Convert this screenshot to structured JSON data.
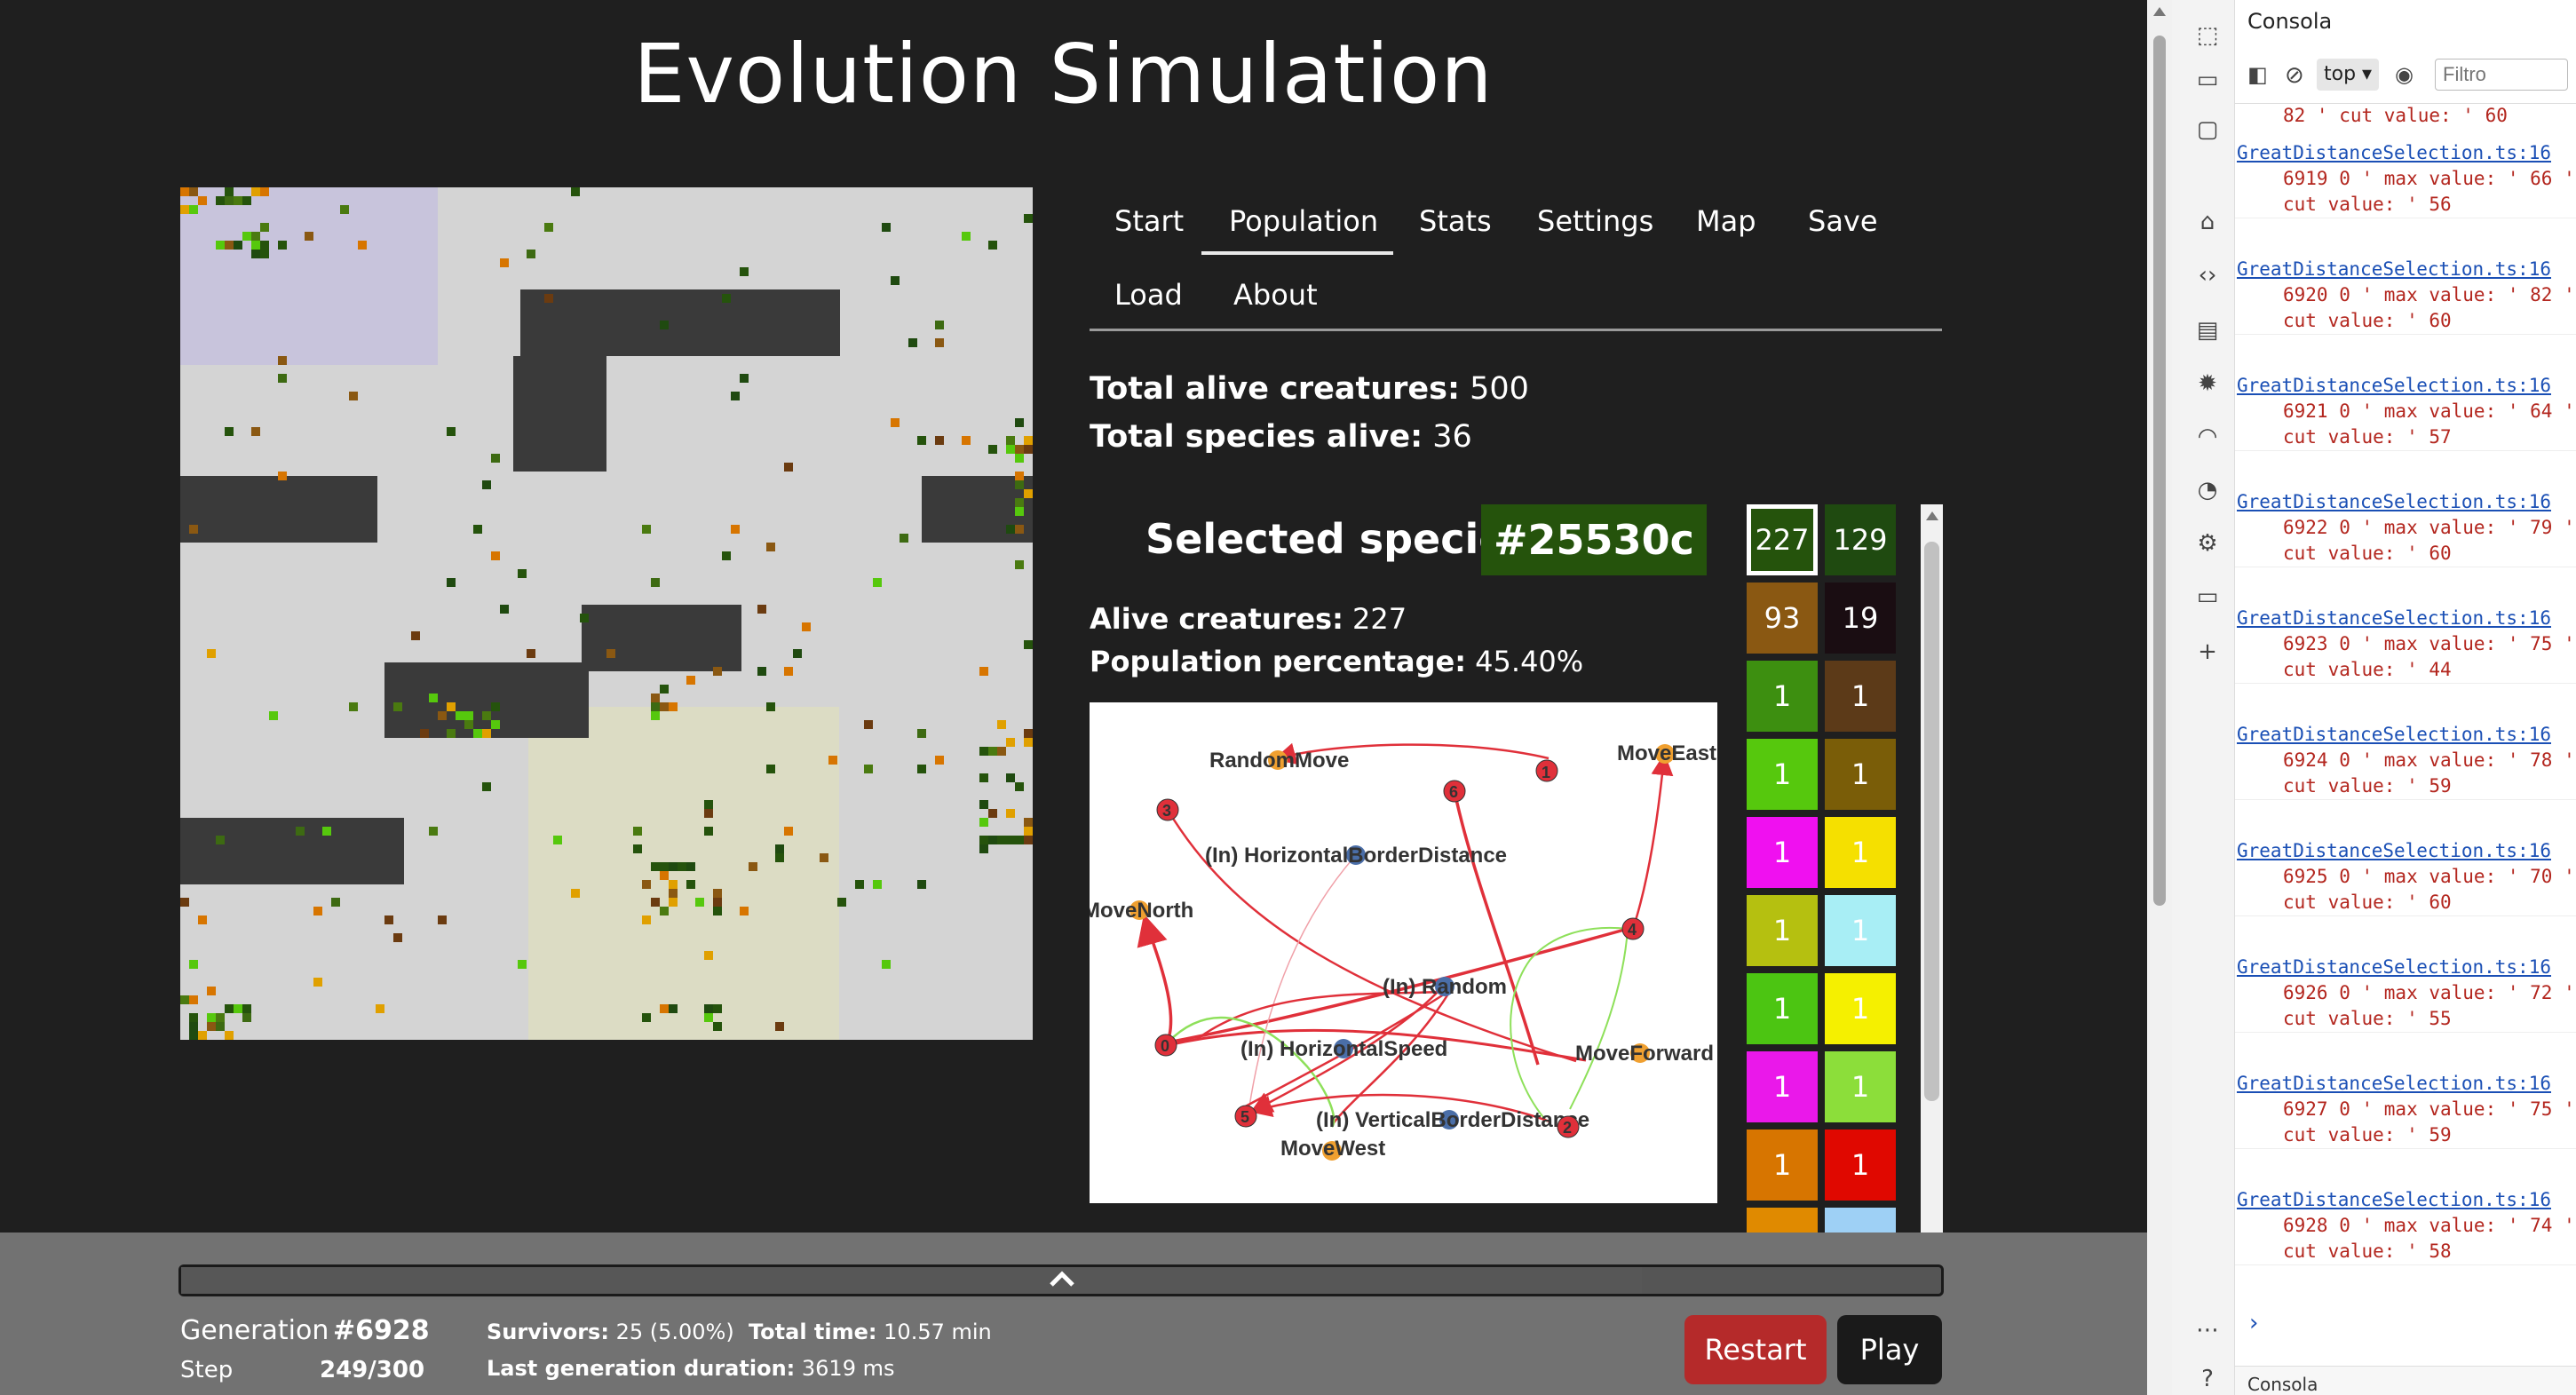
{
  "page": {
    "title": "Evolution Simulation"
  },
  "tabs": [
    {
      "label": "Start"
    },
    {
      "label": "Population",
      "active": true
    },
    {
      "label": "Stats"
    },
    {
      "label": "Settings"
    },
    {
      "label": "Map"
    },
    {
      "label": "Save"
    },
    {
      "label": "Load"
    },
    {
      "label": "About"
    }
  ],
  "population": {
    "total_alive_label": "Total alive creatures:",
    "total_alive_value": "500",
    "species_alive_label": "Total species alive:",
    "species_alive_value": "36",
    "selected_label": "Selected species",
    "selected_code": "#25530c",
    "alive_label": "Alive creatures:",
    "alive_value": "227",
    "pct_label": "Population percentage:",
    "pct_value": "45.40%"
  },
  "species_grid": [
    {
      "count": "227",
      "color": "#25530c",
      "selected": true
    },
    {
      "count": "129",
      "color": "#1f4a10"
    },
    {
      "count": "93",
      "color": "#8a5812"
    },
    {
      "count": "19",
      "color": "#1a0d12"
    },
    {
      "count": "1",
      "color": "#3d8f10"
    },
    {
      "count": "1",
      "color": "#5c3a18"
    },
    {
      "count": "1",
      "color": "#56c80d"
    },
    {
      "count": "1",
      "color": "#7a5d08"
    },
    {
      "count": "1",
      "color": "#f010f0"
    },
    {
      "count": "1",
      "color": "#f5e000"
    },
    {
      "count": "1",
      "color": "#b5c010"
    },
    {
      "count": "1",
      "color": "#a8eef5"
    },
    {
      "count": "1",
      "color": "#4cc512"
    },
    {
      "count": "1",
      "color": "#f5f000"
    },
    {
      "count": "1",
      "color": "#ea18ea"
    },
    {
      "count": "1",
      "color": "#8cde3a"
    },
    {
      "count": "1",
      "color": "#d77500"
    },
    {
      "count": "1",
      "color": "#e00800"
    },
    {
      "count": "",
      "color": "#e08a00"
    },
    {
      "count": "",
      "color": "#9ed0f5"
    }
  ],
  "neural_graph": {
    "nodes": [
      {
        "label": "RandomMove",
        "kind": "output"
      },
      {
        "label": "1",
        "kind": "hidden"
      },
      {
        "label": "MoveEast",
        "kind": "output"
      },
      {
        "label": "3",
        "kind": "hidden"
      },
      {
        "label": "6",
        "kind": "hidden"
      },
      {
        "label": "(In) HorizontalBorderDistance",
        "kind": "input"
      },
      {
        "label": "MoveNorth",
        "kind": "output"
      },
      {
        "label": "4",
        "kind": "hidden"
      },
      {
        "label": "(In) Random",
        "kind": "input"
      },
      {
        "label": "0",
        "kind": "hidden"
      },
      {
        "label": "(In) HorizontalSpeed",
        "kind": "input"
      },
      {
        "label": "MoveForward",
        "kind": "output"
      },
      {
        "label": "5",
        "kind": "hidden"
      },
      {
        "label": "(In) VerticalBorderDistance",
        "kind": "input"
      },
      {
        "label": "2",
        "kind": "hidden"
      },
      {
        "label": "MoveWest",
        "kind": "output"
      }
    ]
  },
  "bottom": {
    "generation_label": "Generation",
    "generation_value": "#6928",
    "step_label": "Step",
    "step_value": "249/300",
    "step_fraction": 0.83,
    "survivors_label": "Survivors:",
    "survivors_value": "25 (5.00%)",
    "total_time_label": "Total time:",
    "total_time_value": "10.57 min",
    "last_gen_label": "Last generation duration:",
    "last_gen_value": "3619 ms",
    "restart_label": "Restart",
    "play_label": "Play",
    "restart_color": "#b52a2a",
    "play_color": "#1a1a1a"
  },
  "devtools": {
    "panel_title": "Consola",
    "context_select": "top",
    "filter_placeholder": "Filtro",
    "first_partial": "82 ' cut value: ' 60",
    "logs": [
      {
        "source": "GreatDistanceSelection.ts:16",
        "text": "6919 0 ' max value: ' 66 ' cut value: ' 56"
      },
      {
        "source": "GreatDistanceSelection.ts:16",
        "text": "6920 0 ' max value: ' 82 ' cut value: ' 60"
      },
      {
        "source": "GreatDistanceSelection.ts:16",
        "text": "6921 0 ' max value: ' 64 ' cut value: ' 57"
      },
      {
        "source": "GreatDistanceSelection.ts:16",
        "text": "6922 0 ' max value: ' 79 ' cut value: ' 60"
      },
      {
        "source": "GreatDistanceSelection.ts:16",
        "text": "6923 0 ' max value: ' 75 ' cut value: ' 44"
      },
      {
        "source": "GreatDistanceSelection.ts:16",
        "text": "6924 0 ' max value: ' 78 ' cut value: ' 59"
      },
      {
        "source": "GreatDistanceSelection.ts:16",
        "text": "6925 0 ' max value: ' 70 ' cut value: ' 60"
      },
      {
        "source": "GreatDistanceSelection.ts:16",
        "text": "6926 0 ' max value: ' 72 ' cut value: ' 55"
      },
      {
        "source": "GreatDistanceSelection.ts:16",
        "text": "6927 0 ' max value: ' 75 ' cut value: ' 59"
      },
      {
        "source": "GreatDistanceSelection.ts:16",
        "text": "6928 0 ' max value: ' 74 ' cut value: ' 58"
      }
    ],
    "bottom_tab": "Consola"
  }
}
